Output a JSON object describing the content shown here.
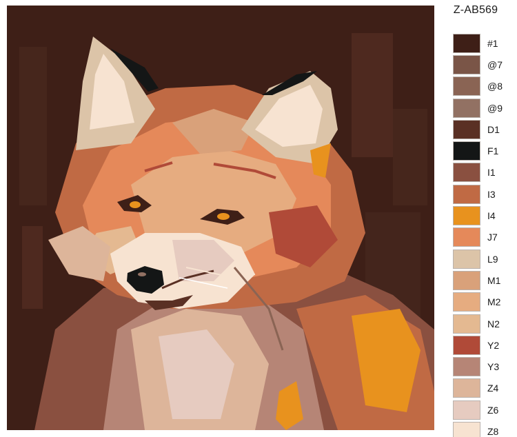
{
  "product_code": "Z-AB569",
  "artwork": {
    "subject_icon": "fox-portrait-artwork"
  },
  "palette": [
    {
      "label": "#1",
      "color": "#3e1f17"
    },
    {
      "label": "@7",
      "color": "#7a5547"
    },
    {
      "label": "@8",
      "color": "#8a6454"
    },
    {
      "label": "@9",
      "color": "#927163"
    },
    {
      "label": "D1",
      "color": "#5a3024"
    },
    {
      "label": "F1",
      "color": "#141616"
    },
    {
      "label": "I1",
      "color": "#8a5040"
    },
    {
      "label": "I3",
      "color": "#c06a44"
    },
    {
      "label": "I4",
      "color": "#e8921e"
    },
    {
      "label": "J7",
      "color": "#e5895a"
    },
    {
      "label": "L9",
      "color": "#dcc4a8"
    },
    {
      "label": "M1",
      "color": "#d9a17a"
    },
    {
      "label": "M2",
      "color": "#e6ac80"
    },
    {
      "label": "N2",
      "color": "#e4b991"
    },
    {
      "label": "Y2",
      "color": "#b04a38"
    },
    {
      "label": "Y3",
      "color": "#b68576"
    },
    {
      "label": "Z4",
      "color": "#ddb59a"
    },
    {
      "label": "Z6",
      "color": "#e6cbc0"
    },
    {
      "label": "Z8",
      "color": "#f7e3d1"
    }
  ]
}
